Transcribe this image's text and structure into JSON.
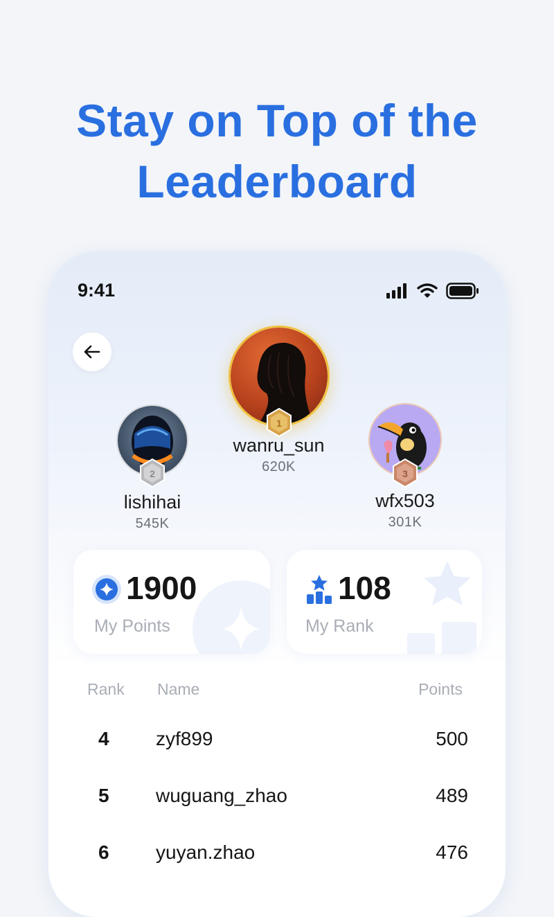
{
  "headline": {
    "line1": "Stay on Top of the",
    "line2": "Leaderboard"
  },
  "status": {
    "time": "9:41"
  },
  "podium": {
    "first": {
      "name": "wanru_sun",
      "score": "620K",
      "medal": "1"
    },
    "second": {
      "name": "lishihai",
      "score": "545K",
      "medal": "2"
    },
    "third": {
      "name": "wfx503",
      "score": "301K",
      "medal": "3"
    }
  },
  "cards": {
    "points": {
      "value": "1900",
      "label": "My Points"
    },
    "rank": {
      "value": "108",
      "label": "My Rank"
    }
  },
  "table": {
    "headers": {
      "rank": "Rank",
      "name": "Name",
      "points": "Points"
    },
    "rows": [
      {
        "rank": "4",
        "name": "zyf899",
        "points": "500"
      },
      {
        "rank": "5",
        "name": "wuguang_zhao",
        "points": "489"
      },
      {
        "rank": "6",
        "name": "yuyan.zhao",
        "points": "476"
      }
    ]
  },
  "colors": {
    "accent": "#2a6fe0",
    "gold": "#e8b93a",
    "silver": "#c9c9cc",
    "bronze": "#d79a80"
  },
  "icons": [
    "arrow-left-icon",
    "signal-icon",
    "wifi-icon",
    "battery-icon",
    "medal-icon",
    "sparkle-icon",
    "podium-star-icon"
  ]
}
